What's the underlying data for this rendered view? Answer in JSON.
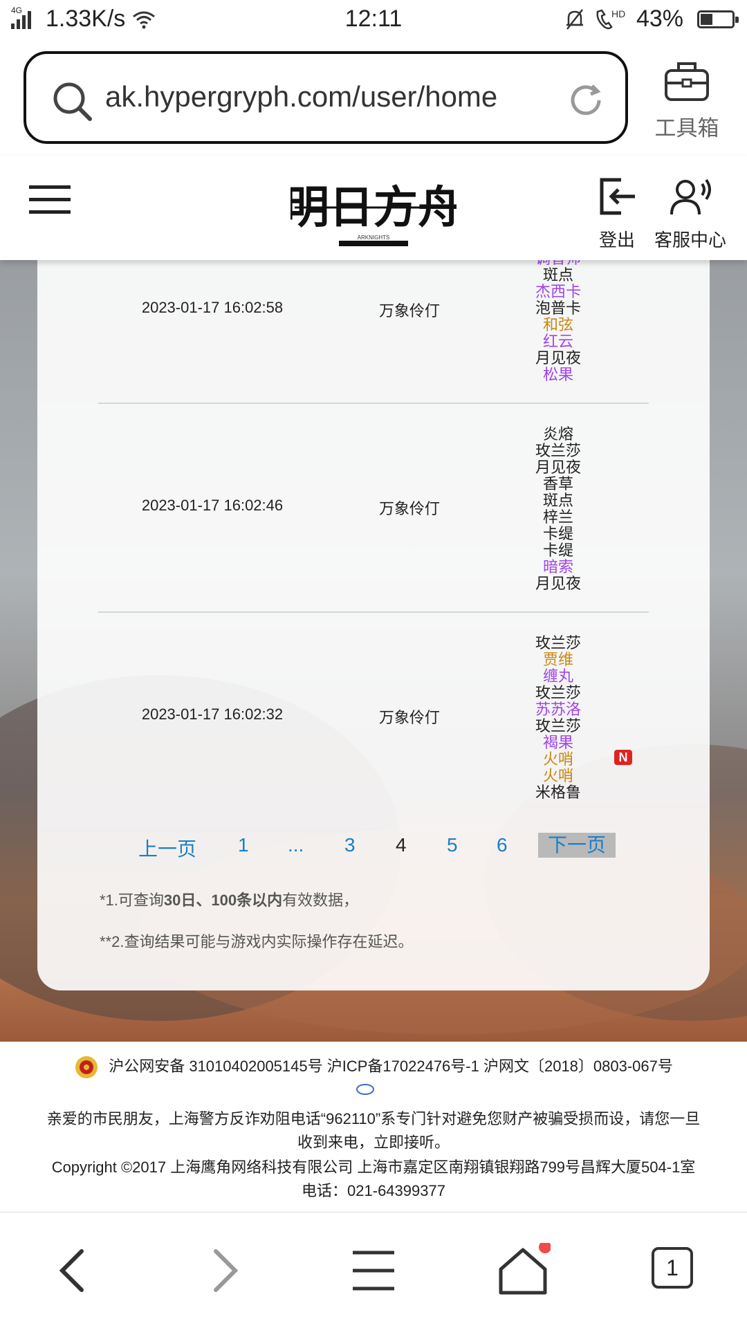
{
  "statusbar": {
    "network": "4G",
    "speed": "1.33K/s",
    "time": "12:11",
    "hd": "HD",
    "battery": "43%"
  },
  "browser": {
    "url": "ak.hypergryph.com/user/home",
    "toolbox_label": "工具箱"
  },
  "site_header": {
    "logo_text": "明日方舟",
    "logo_sub": "ARKNIGHTS",
    "logout_label": "登出",
    "service_label": "客服中心"
  },
  "records": [
    {
      "datetime": "2023-01-17 16:02:58",
      "pool": "万象伶仃",
      "operators": [
        {
          "name": "调香师",
          "rarity": "r4"
        },
        {
          "name": "斑点",
          "rarity": "r3"
        },
        {
          "name": "杰西卡",
          "rarity": "r4"
        },
        {
          "name": "泡普卡",
          "rarity": "r3"
        },
        {
          "name": "和弦",
          "rarity": "r5"
        },
        {
          "name": "红云",
          "rarity": "r4"
        },
        {
          "name": "月见夜",
          "rarity": "r3"
        },
        {
          "name": "松果",
          "rarity": "r4"
        }
      ]
    },
    {
      "datetime": "2023-01-17 16:02:46",
      "pool": "万象伶仃",
      "operators": [
        {
          "name": "炎熔",
          "rarity": "r3"
        },
        {
          "name": "玫兰莎",
          "rarity": "r3"
        },
        {
          "name": "月见夜",
          "rarity": "r3"
        },
        {
          "name": "香草",
          "rarity": "r3"
        },
        {
          "name": "斑点",
          "rarity": "r3"
        },
        {
          "name": "梓兰",
          "rarity": "r3"
        },
        {
          "name": "卡缇",
          "rarity": "r3"
        },
        {
          "name": "卡缇",
          "rarity": "r3"
        },
        {
          "name": "暗索",
          "rarity": "r4"
        },
        {
          "name": "月见夜",
          "rarity": "r3"
        }
      ]
    },
    {
      "datetime": "2023-01-17 16:02:32",
      "pool": "万象伶仃",
      "operators": [
        {
          "name": "玫兰莎",
          "rarity": "r3"
        },
        {
          "name": "贾维",
          "rarity": "r5"
        },
        {
          "name": "缠丸",
          "rarity": "r4"
        },
        {
          "name": "玫兰莎",
          "rarity": "r3"
        },
        {
          "name": "苏苏洛",
          "rarity": "r4"
        },
        {
          "name": "玫兰莎",
          "rarity": "r3"
        },
        {
          "name": "褐果",
          "rarity": "r4"
        },
        {
          "name": "火哨",
          "rarity": "r5",
          "new": "N"
        },
        {
          "name": "火哨",
          "rarity": "r5"
        },
        {
          "name": "米格鲁",
          "rarity": "r3"
        }
      ]
    }
  ],
  "pagination": {
    "prev": "上一页",
    "p1": "1",
    "ellipsis": "...",
    "p3": "3",
    "current": "4",
    "p5": "5",
    "p6": "6",
    "next": "下一页"
  },
  "notes": {
    "n1_pre": "*1.可查询",
    "n1_bold": "30日、100条以内",
    "n1_post": "有效数据，",
    "n2": "**2.查询结果可能与游戏内实际操作存在延迟。"
  },
  "footer": {
    "license": "沪公网安备 31010402005145号  沪ICP备17022476号-1  沪网文〔2018〕0803-067号",
    "warning_line1": "亲爱的市民朋友，上海警方反诈劝阻电话“962110”系专门针对避免您财产被骗受损而设，请您一旦",
    "warning_line2": "收到来电，立即接听。",
    "copyright": "Copyright ©2017 上海鹰角网络科技有限公司  上海市嘉定区南翔镇银翔路799号昌辉大厦504-1室",
    "phone": "电话：021-64399377"
  },
  "bottomnav": {
    "tabs_count": "1"
  },
  "colors": {
    "r3": "#222222",
    "r4": "#a044e8",
    "r5": "#c88714",
    "link": "#1a7fc4"
  }
}
